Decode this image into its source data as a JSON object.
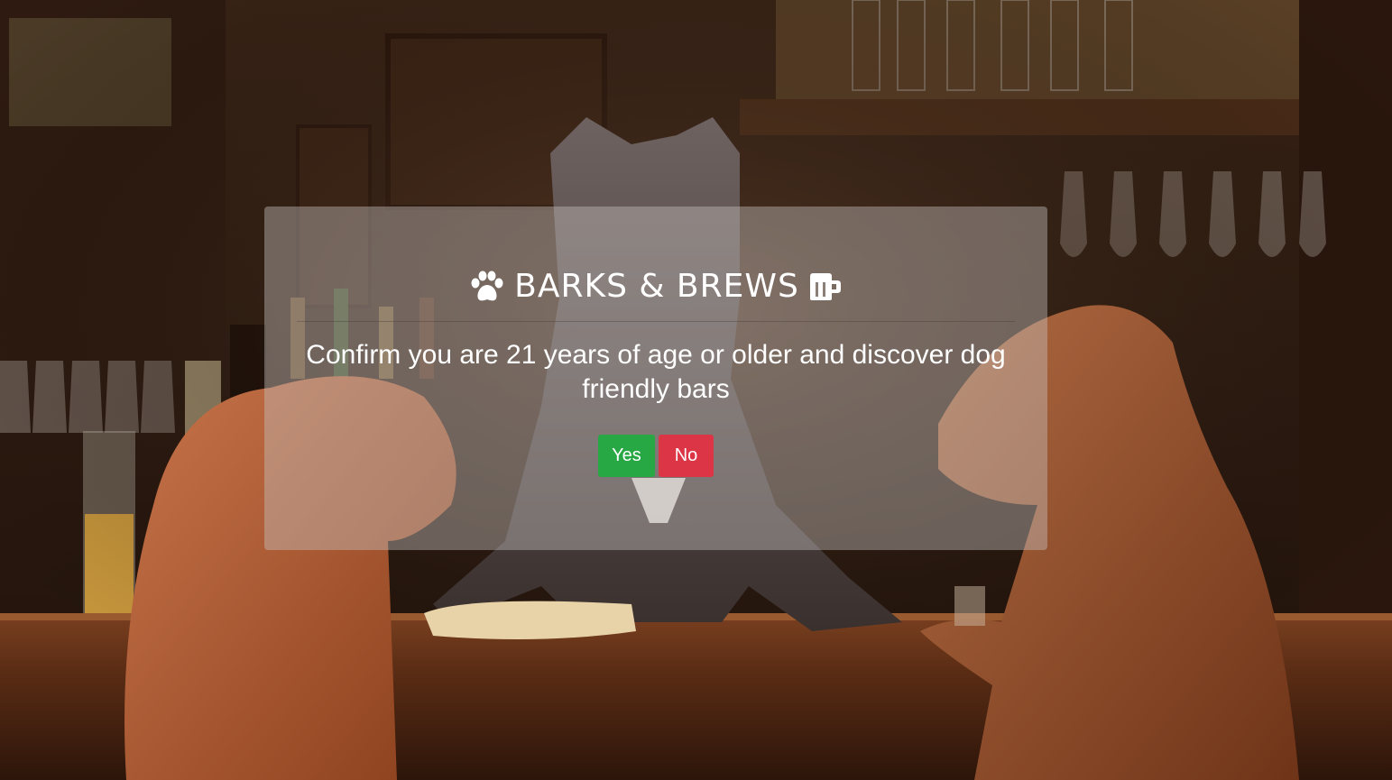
{
  "hero": {
    "description_icon": "dog-bar-photo"
  },
  "age_gate": {
    "brand": {
      "name": "BARKS & BREWS",
      "left_icon": "paw-icon",
      "right_icon": "beer-mug-icon"
    },
    "question": "Confirm you are 21 years of age or older and discover dog friendly bars",
    "buttons": {
      "yes_label": "Yes",
      "no_label": "No"
    }
  },
  "colors": {
    "yes": "#28a745",
    "no": "#dc3545",
    "overlay": "rgba(200,196,192,0.42)",
    "text": "#ffffff"
  }
}
